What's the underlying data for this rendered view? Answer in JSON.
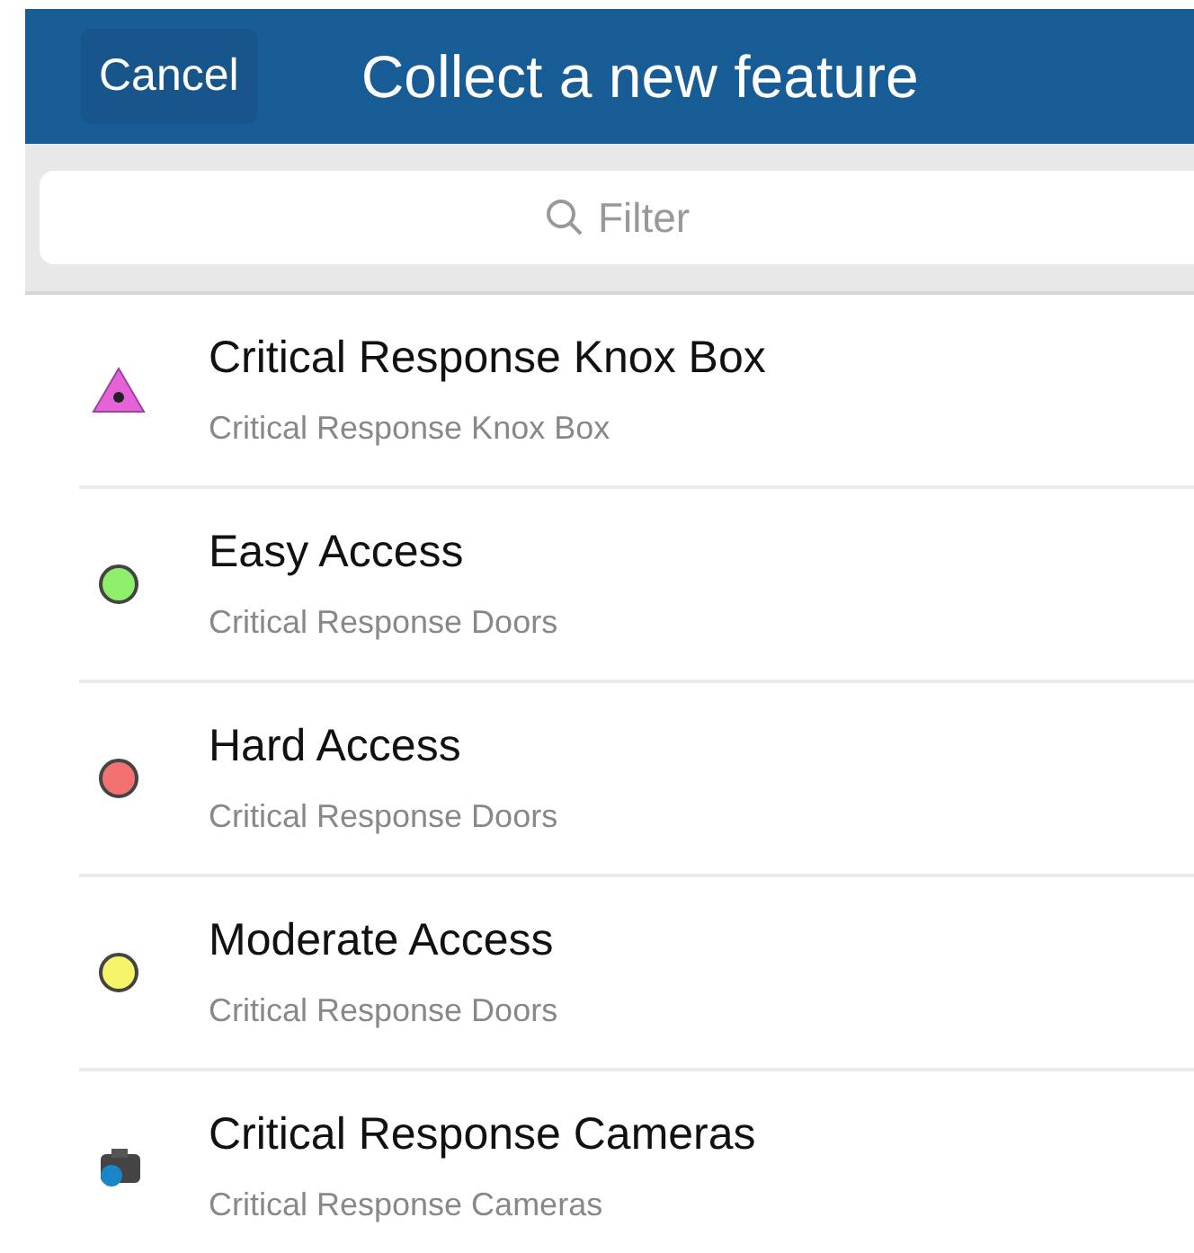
{
  "header": {
    "cancel": "Cancel",
    "title": "Collect a new feature"
  },
  "search": {
    "placeholder": "Filter"
  },
  "items": [
    {
      "kind": "triangle",
      "color": "#e464d8",
      "title": "Critical Response Knox Box",
      "subtitle": "Critical Response Knox Box"
    },
    {
      "kind": "circle",
      "color": "#8ef06a",
      "title": "Easy Access",
      "subtitle": "Critical Response Doors"
    },
    {
      "kind": "circle",
      "color": "#f27272",
      "title": "Hard Access",
      "subtitle": "Critical Response Doors"
    },
    {
      "kind": "circle",
      "color": "#f6f46a",
      "title": "Moderate Access",
      "subtitle": "Critical Response Doors"
    },
    {
      "kind": "camera",
      "title": "Critical Response Cameras",
      "subtitle": "Critical Response Cameras"
    }
  ]
}
